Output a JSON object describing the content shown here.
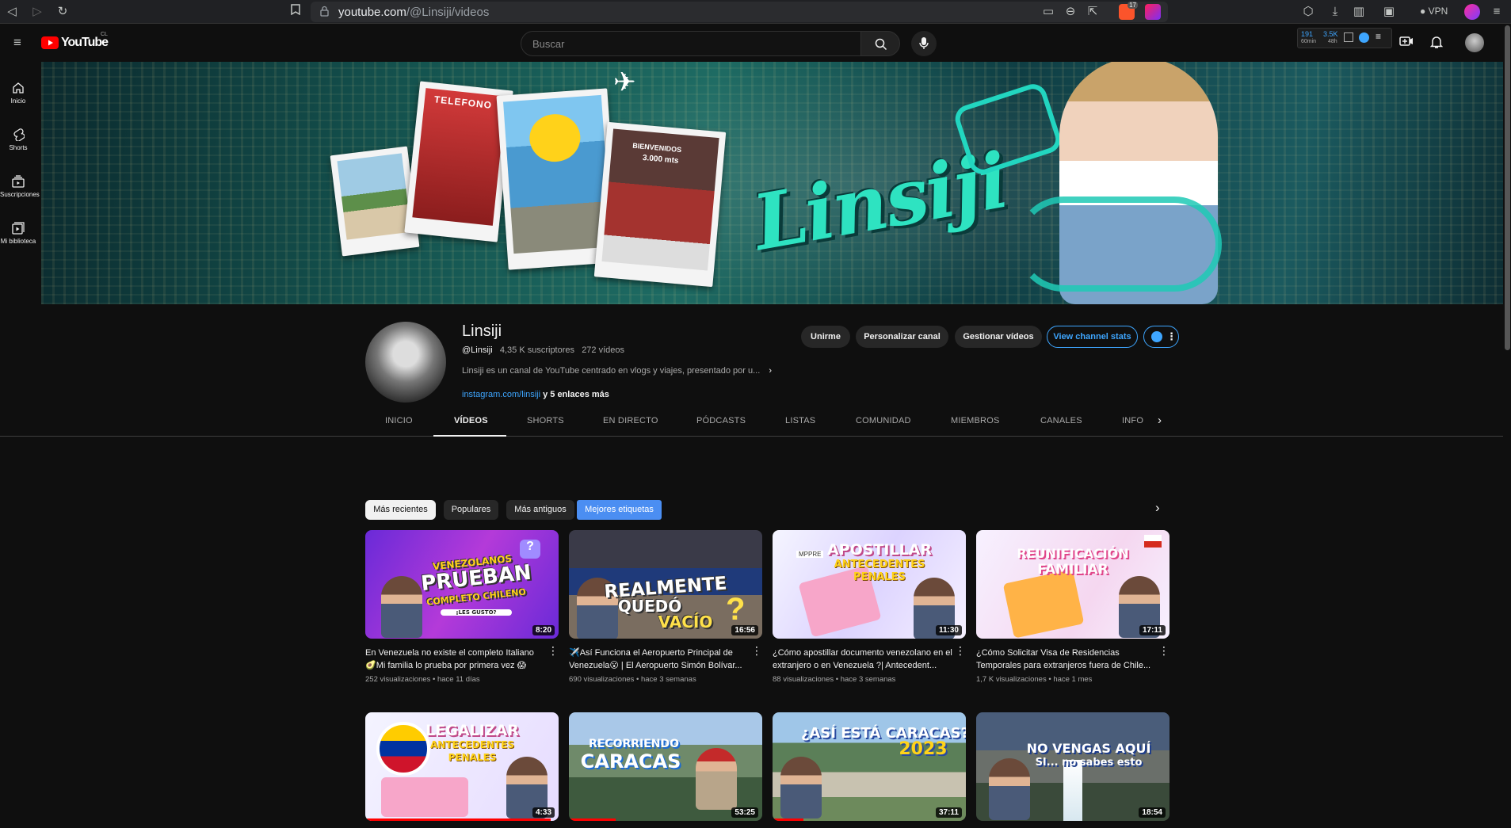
{
  "browser": {
    "url_host": "youtube.com",
    "url_path": "/@Linsiji/videos",
    "vpn_label": "VPN",
    "ext_badge": "17"
  },
  "header": {
    "logo_text": "YouTube",
    "region": "CL",
    "search_placeholder": "Buscar",
    "stats_top": [
      "191",
      "3.5K"
    ],
    "stats_bottom": [
      "60min",
      "48h"
    ]
  },
  "sidebar": {
    "items": [
      {
        "label": "Inicio",
        "icon": "home-icon"
      },
      {
        "label": "Shorts",
        "icon": "shorts-icon"
      },
      {
        "label": "Suscripciones",
        "icon": "subscriptions-icon"
      },
      {
        "label": "Mi biblioteca",
        "icon": "library-icon"
      }
    ]
  },
  "banner": {
    "logo_text": "Linsiji",
    "photo_labels": [
      "TELEFONO",
      "BIENVENIDOS",
      "3.000 mts"
    ]
  },
  "channel": {
    "name": "Linsiji",
    "handle": "@Linsiji",
    "subscribers": "4,35 K suscriptores",
    "videos_count": "272 vídeos",
    "description": "Linsiji es un canal de YouTube centrado en vlogs y viajes, presentado por u...",
    "link_main": "instagram.com/linsiji",
    "link_more": "y 5 enlaces más",
    "buttons": {
      "join": "Unirme",
      "customize": "Personalizar canal",
      "manage": "Gestionar vídeos",
      "stats": "View channel stats"
    }
  },
  "tabs": [
    "INICIO",
    "VÍDEOS",
    "SHORTS",
    "EN DIRECTO",
    "PÓDCASTS",
    "LISTAS",
    "COMUNIDAD",
    "MIEMBROS",
    "CANALES",
    "INFO"
  ],
  "active_tab": "VÍDEOS",
  "chips": [
    "Más recientes",
    "Populares",
    "Más antiguos",
    "Mejores etiquetas"
  ],
  "videos": [
    {
      "title": "En Venezuela no existe el completo Italiano 🥑Mi familia lo prueba por primera vez 😱",
      "meta": "252 visualizaciones • hace 11 días",
      "duration": "8:20",
      "thumb_text": [
        "VENEZOLANOS",
        "PRUEBAN",
        "COMPLETO CHILENO",
        "¡LES GUSTO?"
      ]
    },
    {
      "title": "✈️Así Funciona el Aeropuerto Principal de Venezuela😮 | El Aeropuerto Simón Bolívar...",
      "meta": "690 visualizaciones • hace 3 semanas",
      "duration": "16:56",
      "thumb_text": [
        "REALMENTE",
        "QUEDÓ",
        "VACÍO"
      ]
    },
    {
      "title": "¿Cómo apostillar documento venezolano en el extranjero o en Venezuela ?| Antecedent...",
      "meta": "88 visualizaciones • hace 3 semanas",
      "duration": "11:30",
      "thumb_text": [
        "APOSTILLAR",
        "ANTECEDENTES",
        "PENALES",
        "MPPRE"
      ]
    },
    {
      "title": "¿Cómo Solicitar Visa de Residencias Temporales para extranjeros fuera de Chile...",
      "meta": "1,7 K visualizaciones • hace 1 mes",
      "duration": "17:11",
      "thumb_text": [
        "REUNIFICACIÓN",
        "FAMILIAR"
      ]
    },
    {
      "title": "",
      "meta": "",
      "duration": "4:33",
      "thumb_text": [
        "LEGALIZAR",
        "ANTECEDENTES",
        "PENALES"
      ]
    },
    {
      "title": "",
      "meta": "",
      "duration": "53:25",
      "thumb_text": [
        "RECORRIENDO",
        "CARACAS"
      ]
    },
    {
      "title": "",
      "meta": "",
      "duration": "37:11",
      "thumb_text": [
        "¿ASÍ ESTÁ CARACAS?",
        "2023"
      ]
    },
    {
      "title": "",
      "meta": "",
      "duration": "18:54",
      "thumb_text": [
        "NO VENGAS AQUÍ",
        "SI... no sabes esto"
      ]
    }
  ],
  "colors": {
    "bg": "#0f0f0f",
    "accent_blue": "#3ea6ff",
    "chip_blue": "#4b8ef2",
    "youtube_red": "#ff0000",
    "banner_teal": "#2ee3c1"
  }
}
